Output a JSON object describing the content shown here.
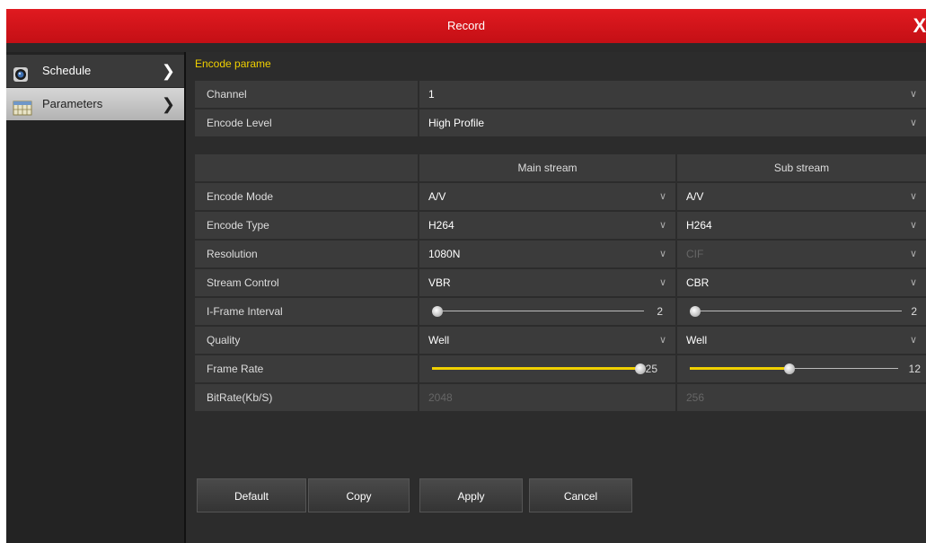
{
  "window": {
    "title": "Record",
    "close_label": "X"
  },
  "sidebar": {
    "items": [
      {
        "label": "Schedule",
        "icon": "camera-icon"
      },
      {
        "label": "Parameters",
        "icon": "calendar-icon"
      }
    ]
  },
  "section_title": "Encode parame",
  "top_fields": {
    "channel": {
      "label": "Channel",
      "value": "1"
    },
    "encode_level": {
      "label": "Encode Level",
      "value": "High Profile"
    }
  },
  "table": {
    "main_header": "Main stream",
    "sub_header": "Sub stream",
    "encode_mode": {
      "label": "Encode Mode",
      "main": "A/V",
      "sub": "A/V"
    },
    "encode_type": {
      "label": "Encode Type",
      "main": "H264",
      "sub": "H264"
    },
    "resolution": {
      "label": "Resolution",
      "main": "1080N",
      "sub": "CIF"
    },
    "stream_control": {
      "label": "Stream Control",
      "main": "VBR",
      "sub": "CBR"
    },
    "iframe": {
      "label": "I-Frame Interval",
      "main": "2",
      "sub": "2",
      "main_fraction": 0,
      "sub_fraction": 0
    },
    "quality": {
      "label": "Quality",
      "main": "Well",
      "sub": "Well"
    },
    "frame_rate": {
      "label": "Frame Rate",
      "main": "25",
      "sub": "12",
      "main_fraction": 1.0,
      "sub_fraction": 0.48
    },
    "bitrate": {
      "label": "BitRate(Kb/S)",
      "main": "2048",
      "sub": "256"
    }
  },
  "buttons": {
    "default": "Default",
    "copy": "Copy",
    "apply": "Apply",
    "cancel": "Cancel"
  },
  "colors": {
    "title_red": "#d0151b",
    "accent_yellow": "#f0d000"
  }
}
